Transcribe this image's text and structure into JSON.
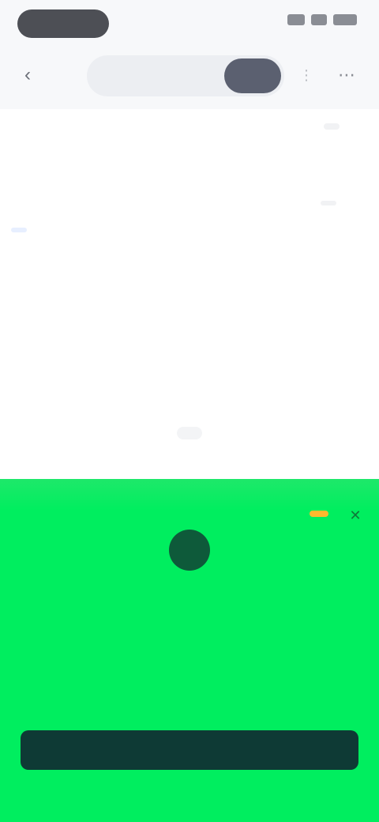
{
  "status_bar": {
    "time": "",
    "icons": [
      "signal-icon",
      "wifi-icon",
      "battery-icon"
    ]
  },
  "nav": {
    "back_icon": "chevron-left-icon",
    "segments": [
      {
        "label": ""
      },
      {
        "label": ""
      }
    ],
    "active_segment": 1,
    "menu_icon": "more-icon",
    "extra_icon": "share-icon"
  },
  "market": {
    "badge": "",
    "question": "",
    "meta_left": "",
    "meta_right": "",
    "link_chip": "",
    "footer_link": ""
  },
  "promo": {
    "tag": "",
    "close_icon": "close-icon",
    "title": "",
    "subtitle": "",
    "body_main": "",
    "body_highlight": "",
    "body_tail": "",
    "cta_label": ""
  },
  "colors": {
    "promo_green": "#00ee5f",
    "cta_dark": "#0e3a35",
    "active_segment": "#5b6070",
    "tag_orange": "#ffb92e",
    "link_blue": "#5b8def"
  }
}
